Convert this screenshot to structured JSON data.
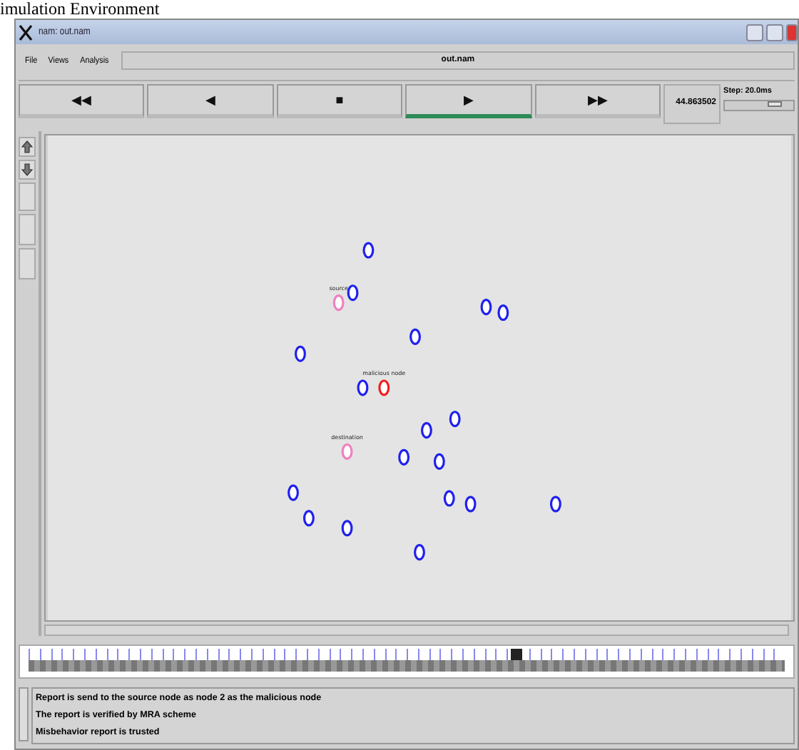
{
  "caption": "imulation Environment",
  "window": {
    "title": "nam: out.nam"
  },
  "menu": [
    "File",
    "Views",
    "Analysis"
  ],
  "file_name": "out.nam",
  "controls": [
    {
      "glyph": "◀◀",
      "selected": false
    },
    {
      "glyph": "◀",
      "selected": false
    },
    {
      "glyph": "■",
      "selected": false
    },
    {
      "glyph": "▶",
      "selected": true
    },
    {
      "glyph": "▶▶",
      "selected": false
    }
  ],
  "time": "44.863502",
  "step": {
    "label": "Step: 20.0ms",
    "level": 0.8
  },
  "nodes": [
    {
      "color": "#2020ee"
    },
    {
      "color": "#2020ee"
    },
    {
      "color": "#2020ee"
    },
    {
      "color": "#2020ee"
    },
    {
      "color": "#2020ee"
    },
    {
      "color": "#2020ee"
    },
    {
      "color": "#2020ee"
    },
    {
      "color": "#2020ee"
    },
    {
      "color": "#2020ee"
    },
    {
      "color": "#2020ee"
    },
    {
      "color": "#2020ee"
    },
    {
      "color": "#2020ee"
    },
    {
      "color": "#2020ee"
    },
    {
      "color": "#2020ee"
    },
    {
      "color": "#2020ee"
    },
    {
      "color": "#2020ee"
    },
    {
      "color": "#2020ee"
    },
    {
      "color": "#2020ee"
    },
    {
      "color": "#f080c0",
      "label": "source"
    },
    {
      "color": "#f080c0",
      "label": "destination"
    },
    {
      "color": "#ee2020",
      "label": "malicious node"
    }
  ],
  "timeline": {
    "level": 0.64
  },
  "log": [
    "Report is send to the source node as node 2 as the malicious node",
    "The report is verified by MRA scheme",
    "Misbehavior report is trusted"
  ]
}
